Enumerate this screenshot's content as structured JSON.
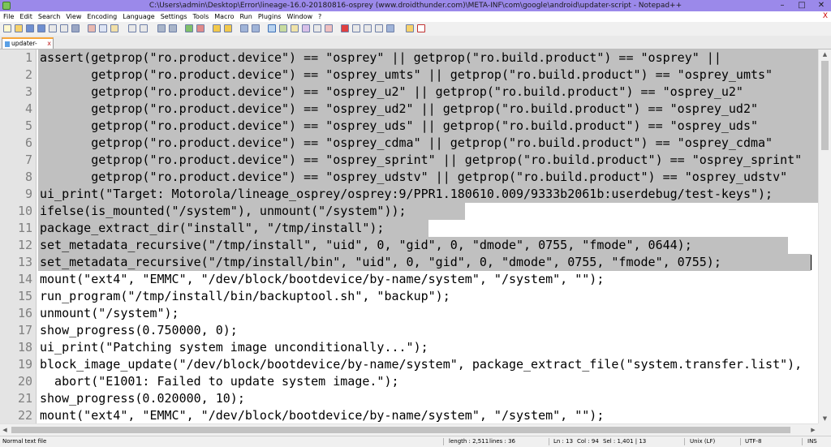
{
  "window": {
    "title": "C:\\Users\\admin\\Desktop\\Error\\lineage-16.0-20180816-osprey (www.droidthunder.com)\\META-INF\\com\\google\\android\\updater-script - Notepad++",
    "minimize": "–",
    "maximize": "□",
    "close": "✕"
  },
  "menu": {
    "items": [
      "File",
      "Edit",
      "Search",
      "View",
      "Encoding",
      "Language",
      "Settings",
      "Tools",
      "Macro",
      "Run",
      "Plugins",
      "Window",
      "?"
    ],
    "close": "X"
  },
  "tab": {
    "label": "updater-script",
    "close": "x"
  },
  "editor": {
    "lines": [
      {
        "n": "1",
        "code": "assert(getprop(\"ro.product.device\") == \"osprey\" || getprop(\"ro.build.product\") == \"osprey\" || "
      },
      {
        "n": "2",
        "code": "       getprop(\"ro.product.device\") == \"osprey_umts\" || getprop(\"ro.build.product\") == \"osprey_umts\""
      },
      {
        "n": "3",
        "code": "       getprop(\"ro.product.device\") == \"osprey_u2\" || getprop(\"ro.build.product\") == \"osprey_u2\""
      },
      {
        "n": "4",
        "code": "       getprop(\"ro.product.device\") == \"osprey_ud2\" || getprop(\"ro.build.product\") == \"osprey_ud2\""
      },
      {
        "n": "5",
        "code": "       getprop(\"ro.product.device\") == \"osprey_uds\" || getprop(\"ro.build.product\") == \"osprey_uds\""
      },
      {
        "n": "6",
        "code": "       getprop(\"ro.product.device\") == \"osprey_cdma\" || getprop(\"ro.build.product\") == \"osprey_cdma\""
      },
      {
        "n": "7",
        "code": "       getprop(\"ro.product.device\") == \"osprey_sprint\" || getprop(\"ro.build.product\") == \"osprey_sprint\""
      },
      {
        "n": "8",
        "code": "       getprop(\"ro.product.device\") == \"osprey_udstv\" || getprop(\"ro.build.product\") == \"osprey_udstv\""
      },
      {
        "n": "9",
        "code": "ui_print(\"Target: Motorola/lineage_osprey/osprey:9/PPR1.180610.009/9333b2061b:userdebug/test-keys\");"
      },
      {
        "n": "10",
        "code": "ifelse(is_mounted(\"/system\"), unmount(\"/system\"));"
      },
      {
        "n": "11",
        "code": "package_extract_dir(\"install\", \"/tmp/install\");"
      },
      {
        "n": "12",
        "code": "set_metadata_recursive(\"/tmp/install\", \"uid\", 0, \"gid\", 0, \"dmode\", 0755, \"fmode\", 0644);"
      },
      {
        "n": "13",
        "code": "set_metadata_recursive(\"/tmp/install/bin\", \"uid\", 0, \"gid\", 0, \"dmode\", 0755, \"fmode\", 0755);"
      },
      {
        "n": "14",
        "code": "mount(\"ext4\", \"EMMC\", \"/dev/block/bootdevice/by-name/system\", \"/system\", \"\");"
      },
      {
        "n": "15",
        "code": "run_program(\"/tmp/install/bin/backuptool.sh\", \"backup\");"
      },
      {
        "n": "16",
        "code": "unmount(\"/system\");"
      },
      {
        "n": "17",
        "code": "show_progress(0.750000, 0);"
      },
      {
        "n": "18",
        "code": "ui_print(\"Patching system image unconditionally...\");"
      },
      {
        "n": "19",
        "code": "block_image_update(\"/dev/block/bootdevice/by-name/system\", package_extract_file(\"system.transfer.list\"),"
      },
      {
        "n": "20",
        "code": "  abort(\"E1001: Failed to update system image.\");"
      },
      {
        "n": "21",
        "code": "show_progress(0.020000, 10);"
      },
      {
        "n": "22",
        "code": "mount(\"ext4\", \"EMMC\", \"/dev/block/bootdevice/by-name/system\", \"/system\", \"\");"
      }
    ]
  },
  "status": {
    "filetype": "Normal text file",
    "length": "length : 2,511",
    "lines": "lines : 36",
    "ln": "Ln : 13",
    "col": "Col : 94",
    "sel": "Sel : 1,401 | 13",
    "eol": "Unix (LF)",
    "encoding": "UTF-8",
    "mode": "INS"
  },
  "colors": {
    "titlebar": "#9b89ea",
    "selection": "#c0c0c0",
    "gutter": "#e4e4e4"
  }
}
